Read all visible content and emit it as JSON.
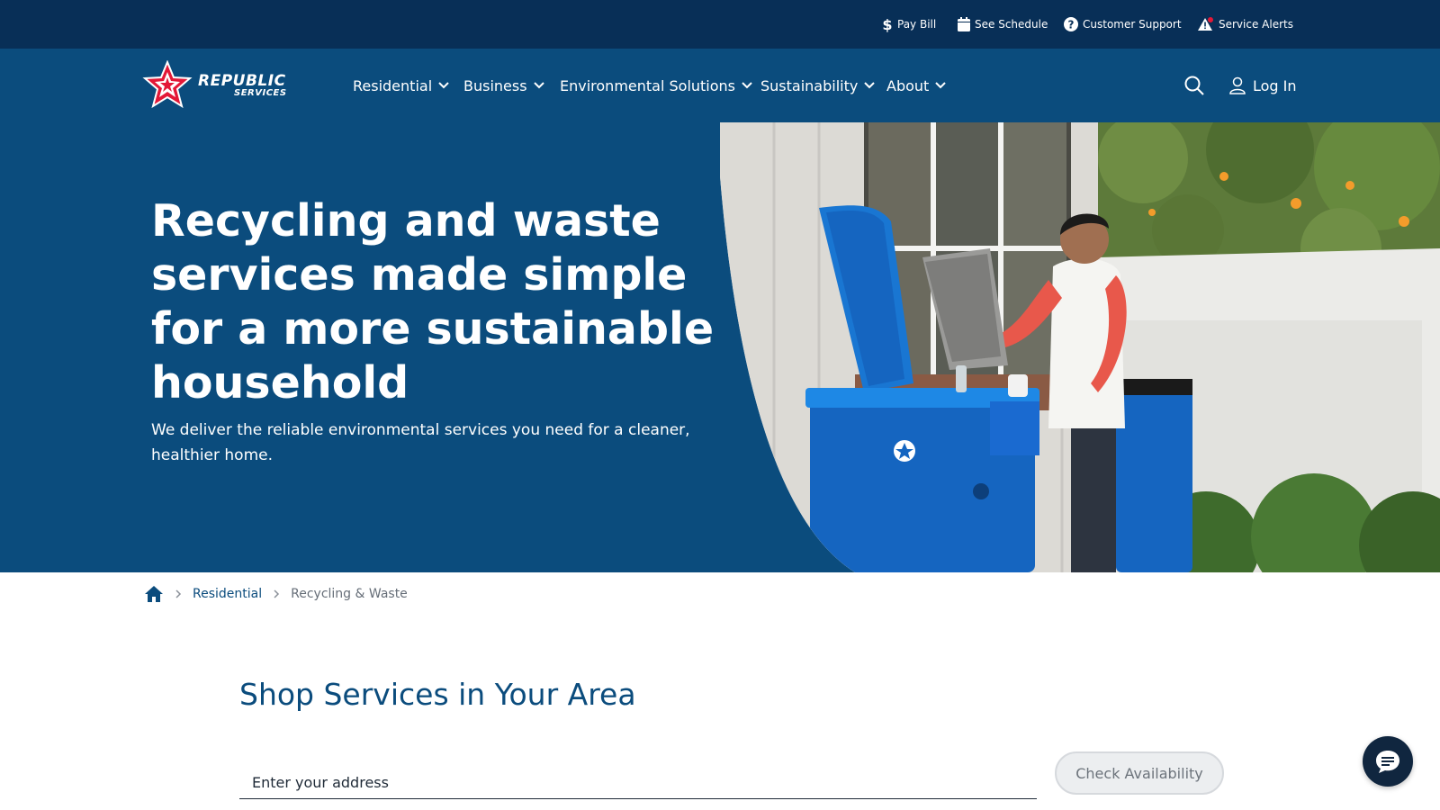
{
  "utility_bar": {
    "links": [
      {
        "label": "Pay Bill",
        "icon": "dollar-icon"
      },
      {
        "label": "See Schedule",
        "icon": "calendar-icon"
      },
      {
        "label": "Customer Support",
        "icon": "question-circle-icon"
      },
      {
        "label": "Service Alerts",
        "icon": "warning-triangle-icon"
      }
    ]
  },
  "header": {
    "logo": {
      "line1": "REPUBLIC",
      "line2": "SERVICES"
    },
    "nav": [
      {
        "label": "Residential"
      },
      {
        "label": "Business"
      },
      {
        "label": "Environmental Solutions"
      },
      {
        "label": "Sustainability"
      },
      {
        "label": "About"
      }
    ],
    "login_label": "Log In"
  },
  "hero": {
    "title": "Recycling and waste services made simple for a more sustainable household",
    "subtitle": "We deliver the reliable environmental services you need for a cleaner, healthier home."
  },
  "breadcrumb": {
    "items": [
      "Residential",
      "Recycling & Waste"
    ]
  },
  "shop": {
    "title": "Shop Services in Your Area",
    "address_placeholder": "Enter your address",
    "check_label": "Check Availability"
  },
  "colors": {
    "utility_bg": "#082f57",
    "header_bg": "#0b4c7d",
    "brand_red": "#e31837",
    "bin_blue": "#1565c0",
    "text_dark": "#1f2a37"
  }
}
